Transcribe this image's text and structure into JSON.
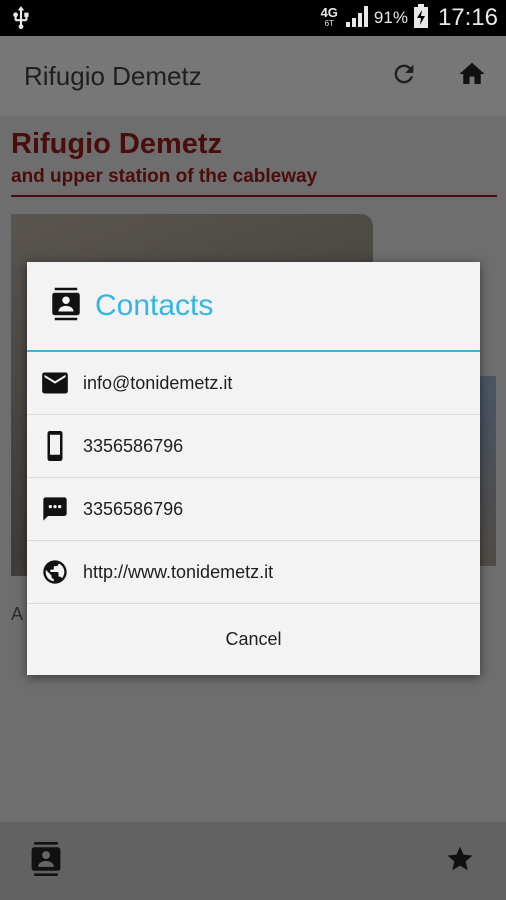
{
  "status_bar": {
    "network": "4G",
    "network_sub": "6T",
    "battery": "91%",
    "time": "17:16"
  },
  "app_bar": {
    "title": "Rifugio Demetz",
    "icons": [
      "refresh-icon",
      "home-icon"
    ]
  },
  "content": {
    "title": "Rifugio Demetz",
    "subtitle": "and upper station of the cableway",
    "caption_fragment": "A"
  },
  "dialog": {
    "title": "Contacts",
    "title_color": "#33b5e5",
    "items": [
      {
        "icon": "email-icon",
        "text": "info@tonidemetz.it"
      },
      {
        "icon": "phone-icon",
        "text": "3356586796"
      },
      {
        "icon": "sms-icon",
        "text": "3356586796"
      },
      {
        "icon": "globe-icon",
        "text": "http://www.tonidemetz.it"
      }
    ],
    "cancel_label": "Cancel"
  },
  "bottom_bar": {
    "icons": [
      "contacts-icon",
      "star-icon"
    ]
  }
}
